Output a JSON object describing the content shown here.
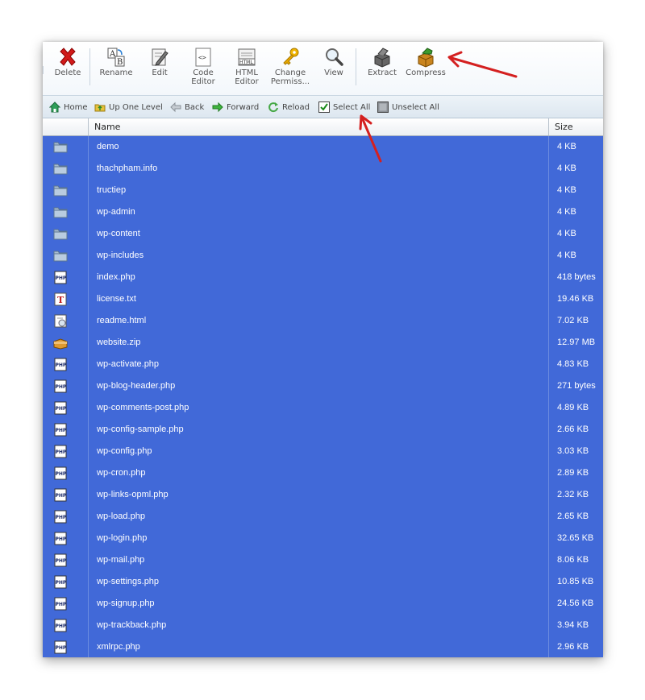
{
  "toolbar": {
    "items": [
      {
        "label": "Delete",
        "icon": "red-x-icon"
      },
      {
        "label": "Rename",
        "icon": "rename-ab-icon"
      },
      {
        "label": "Edit",
        "icon": "edit-pencil-icon"
      },
      {
        "label": "Code\nEditor",
        "icon": "code-editor-icon"
      },
      {
        "label": "HTML\nEditor",
        "icon": "html-editor-icon"
      },
      {
        "label": "Change\nPermiss...",
        "icon": "key-icon"
      },
      {
        "label": "View",
        "icon": "magnifier-icon"
      },
      {
        "label": "Extract",
        "icon": "extract-box-icon"
      },
      {
        "label": "Compress",
        "icon": "compress-box-icon"
      }
    ]
  },
  "nav": {
    "home": "Home",
    "up_one_level": "Up One Level",
    "back": "Back",
    "forward": "Forward",
    "reload": "Reload",
    "select_all": "Select All",
    "unselect_all": "Unselect All"
  },
  "table": {
    "col_name": "Name",
    "col_size": "Size",
    "rows": [
      {
        "icon": "folder",
        "name": "demo",
        "size": "4 KB"
      },
      {
        "icon": "folder",
        "name": "thachpham.info",
        "size": "4 KB"
      },
      {
        "icon": "folder",
        "name": "tructiep",
        "size": "4 KB"
      },
      {
        "icon": "folder",
        "name": "wp-admin",
        "size": "4 KB"
      },
      {
        "icon": "folder",
        "name": "wp-content",
        "size": "4 KB"
      },
      {
        "icon": "folder",
        "name": "wp-includes",
        "size": "4 KB"
      },
      {
        "icon": "php",
        "name": "index.php",
        "size": "418 bytes"
      },
      {
        "icon": "txt",
        "name": "license.txt",
        "size": "19.46 KB"
      },
      {
        "icon": "html",
        "name": "readme.html",
        "size": "7.02 KB"
      },
      {
        "icon": "zip",
        "name": "website.zip",
        "size": "12.97 MB"
      },
      {
        "icon": "php",
        "name": "wp-activate.php",
        "size": "4.83 KB"
      },
      {
        "icon": "php",
        "name": "wp-blog-header.php",
        "size": "271 bytes"
      },
      {
        "icon": "php",
        "name": "wp-comments-post.php",
        "size": "4.89 KB"
      },
      {
        "icon": "php",
        "name": "wp-config-sample.php",
        "size": "2.66 KB"
      },
      {
        "icon": "php",
        "name": "wp-config.php",
        "size": "3.03 KB"
      },
      {
        "icon": "php",
        "name": "wp-cron.php",
        "size": "2.89 KB"
      },
      {
        "icon": "php",
        "name": "wp-links-opml.php",
        "size": "2.32 KB"
      },
      {
        "icon": "php",
        "name": "wp-load.php",
        "size": "2.65 KB"
      },
      {
        "icon": "php",
        "name": "wp-login.php",
        "size": "32.65 KB"
      },
      {
        "icon": "php",
        "name": "wp-mail.php",
        "size": "8.06 KB"
      },
      {
        "icon": "php",
        "name": "wp-settings.php",
        "size": "10.85 KB"
      },
      {
        "icon": "php",
        "name": "wp-signup.php",
        "size": "24.56 KB"
      },
      {
        "icon": "php",
        "name": "wp-trackback.php",
        "size": "3.94 KB"
      },
      {
        "icon": "php",
        "name": "xmlrpc.php",
        "size": "2.96 KB"
      }
    ]
  },
  "colors": {
    "selection": "#4169d8",
    "annotation_arrow": "#d42020"
  }
}
